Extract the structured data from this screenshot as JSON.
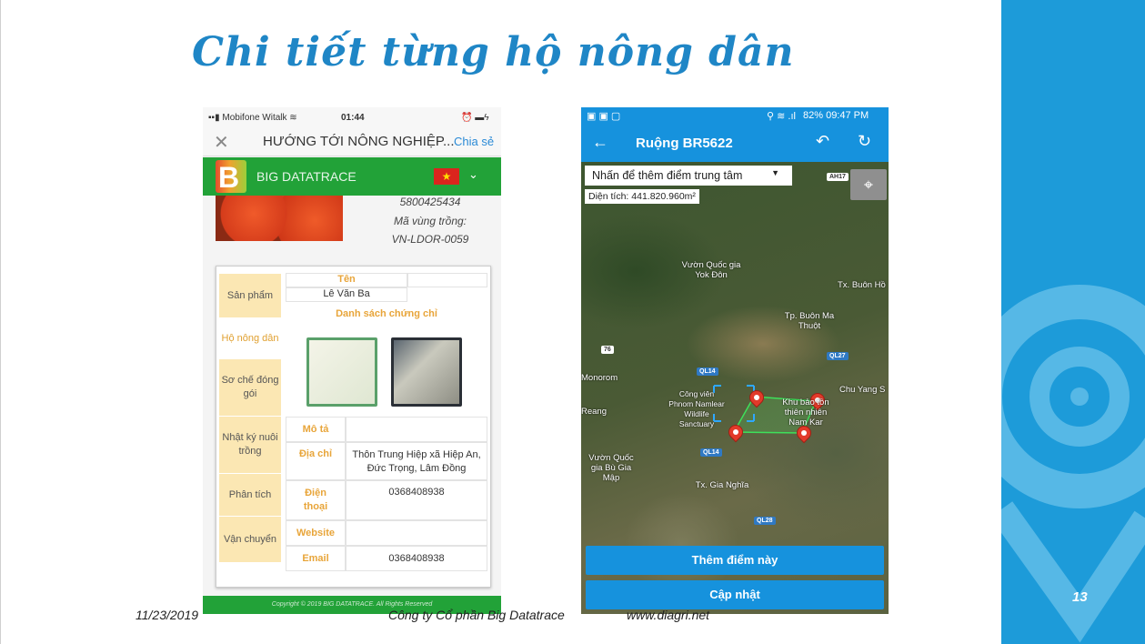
{
  "slide": {
    "title": "Chi tiết từng hộ nông dân",
    "date": "11/23/2019",
    "company": "Công ty Cổ phần Big Datatrace",
    "website": "www.diagri.net",
    "page_number": "13",
    "accent": "#1d9bd9"
  },
  "phone_left": {
    "status": {
      "carrier": "Mobifone Witalk",
      "time": "01:44"
    },
    "nav": {
      "title": "HƯỚNG TỚI NÔNG NGHIỆP...",
      "share": "Chia sẻ",
      "close_icon": "close-icon"
    },
    "brand": {
      "logo_letter": "B",
      "name": "BIG DATATRACE",
      "flag": "★",
      "menu_icon": "chevron-down-icon",
      "color": "#22a238"
    },
    "meta": [
      "5800425434",
      "Mã vùng trồng:",
      "VN-LDOR-0059"
    ],
    "tabs": [
      "Sản phẩm",
      "Hộ nông dân",
      "Sơ chế đóng gói",
      "Nhật ký nuôi trồng",
      "Phân tích",
      "Vận chuyển"
    ],
    "farmer": {
      "name_label": "Tên",
      "name_value": "Lê Văn Ba",
      "cert_title": "Danh sách chứng chỉ",
      "desc_label": "Mô tả",
      "desc_value": "",
      "address_label": "Địa chỉ",
      "address_value": "Thôn Trung Hiệp xã Hiệp An, Đức Trọng, Lâm Đồng",
      "phone_label": "Điện thoại",
      "phone_value": "0368408938",
      "website_label": "Website",
      "website_value": "",
      "email_label": "Email",
      "email_value": "0368408938"
    },
    "footer": "Copyright © 2019 BIG DATATRACE. All Rights Reserved"
  },
  "phone_right": {
    "status": {
      "right": "82% 09:47 PM"
    },
    "bar": {
      "title": "Ruộng BR5622",
      "back_icon": "arrow-left-icon",
      "undo_icon": "undo-icon",
      "refresh_icon": "refresh-icon"
    },
    "dropdown": "Nhấn để thêm điểm trung tâm",
    "area": "Diện tích: 441.820.960m²",
    "map_labels": {
      "yokdon": "Vườn Quốc gia Yok Đôn",
      "buonho": "Tx. Buôn Hồ",
      "bmt": "Tp. Buôn Ma Thuột",
      "monorom": "Monorom",
      "chuyang": "Chu Yang S",
      "phnom": "Công viên Phnom Namlear Wildlife Sanctuary",
      "reang": "Reang",
      "namkar": "Khu bảo tồn thiên nhiên Nam Kar",
      "giamap": "Vườn Quốc gia Bù Gia Mập",
      "gianghia": "Tx. Gia Nghĩa"
    },
    "roads": {
      "ah17": "AH17",
      "r76": "76",
      "ql14a": "QL14",
      "ql27": "QL27",
      "ql14b": "QL14",
      "ql28": "QL28"
    },
    "add_point": "Thêm điểm này",
    "update": "Cập nhật"
  }
}
